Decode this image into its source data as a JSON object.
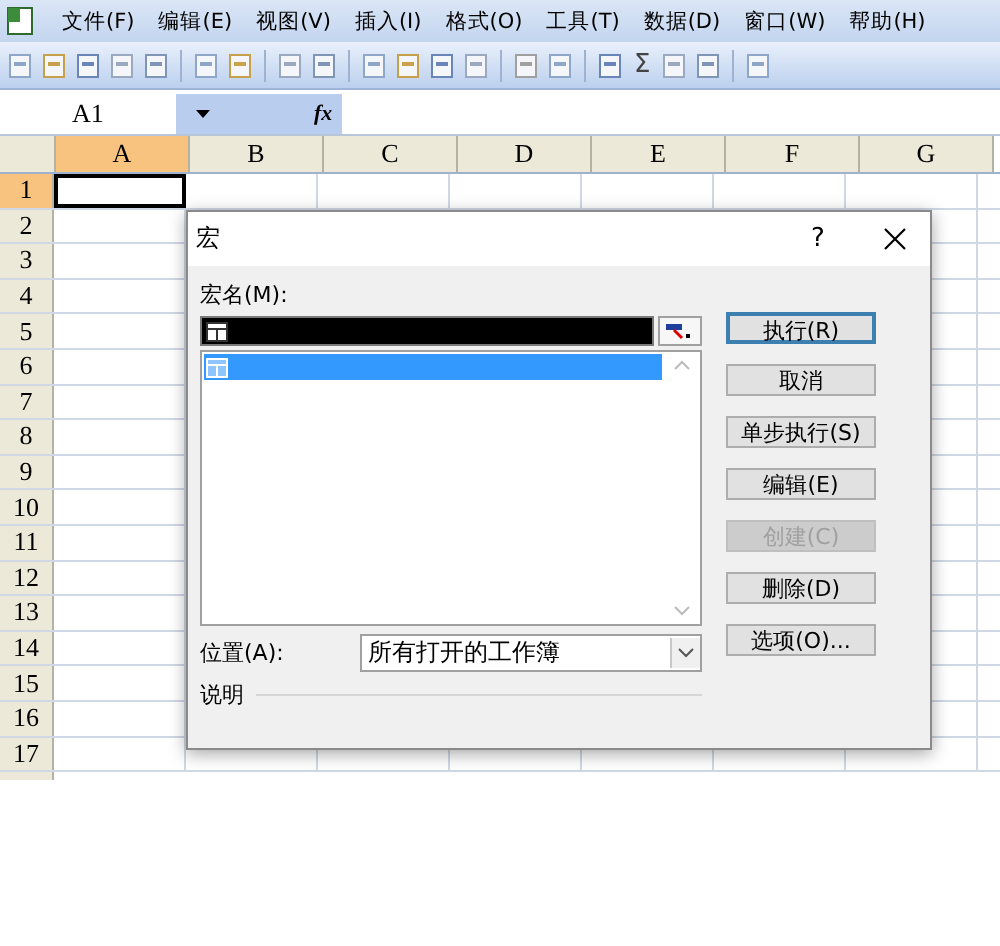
{
  "menu": [
    "文件(F)",
    "编辑(E)",
    "视图(V)",
    "插入(I)",
    "格式(O)",
    "工具(T)",
    "数据(D)",
    "窗口(W)",
    "帮助(H)"
  ],
  "toolbar": {
    "sum_symbol": "Σ"
  },
  "formula_bar": {
    "name_box": "A1",
    "fx_label": "fx"
  },
  "columns": [
    {
      "label": "A",
      "selected": true
    },
    {
      "label": "B",
      "selected": false
    },
    {
      "label": "C",
      "selected": false
    },
    {
      "label": "D",
      "selected": false
    },
    {
      "label": "E",
      "selected": false
    },
    {
      "label": "F",
      "selected": false
    },
    {
      "label": "G",
      "selected": false
    }
  ],
  "rows": [
    {
      "label": "1",
      "selected": true
    },
    {
      "label": "2",
      "selected": false
    },
    {
      "label": "3",
      "selected": false
    },
    {
      "label": "4",
      "selected": false
    },
    {
      "label": "5",
      "selected": false
    },
    {
      "label": "6",
      "selected": false
    },
    {
      "label": "7",
      "selected": false
    },
    {
      "label": "8",
      "selected": false
    },
    {
      "label": "9",
      "selected": false
    },
    {
      "label": "10",
      "selected": false
    },
    {
      "label": "11",
      "selected": false
    },
    {
      "label": "12",
      "selected": false
    },
    {
      "label": "13",
      "selected": false
    },
    {
      "label": "14",
      "selected": false
    },
    {
      "label": "15",
      "selected": false
    },
    {
      "label": "16",
      "selected": false
    },
    {
      "label": "17",
      "selected": false
    }
  ],
  "dialog": {
    "title": "宏",
    "help": "?",
    "macro_name_label": "宏名(M):",
    "macros": [
      {
        "selected": true
      }
    ],
    "buttons": [
      {
        "label": "执行(R)",
        "default": true,
        "disabled": false
      },
      {
        "label": "取消",
        "default": false,
        "disabled": false
      },
      {
        "label": "单步执行(S)",
        "default": false,
        "disabled": false
      },
      {
        "label": "编辑(E)",
        "default": false,
        "disabled": false
      },
      {
        "label": "创建(C)",
        "default": false,
        "disabled": true
      },
      {
        "label": "删除(D)",
        "default": false,
        "disabled": false
      },
      {
        "label": "选项(O)...",
        "default": false,
        "disabled": false
      }
    ],
    "location_label": "位置(A):",
    "location_value": "所有打开的工作簿",
    "description_label": "说明"
  }
}
